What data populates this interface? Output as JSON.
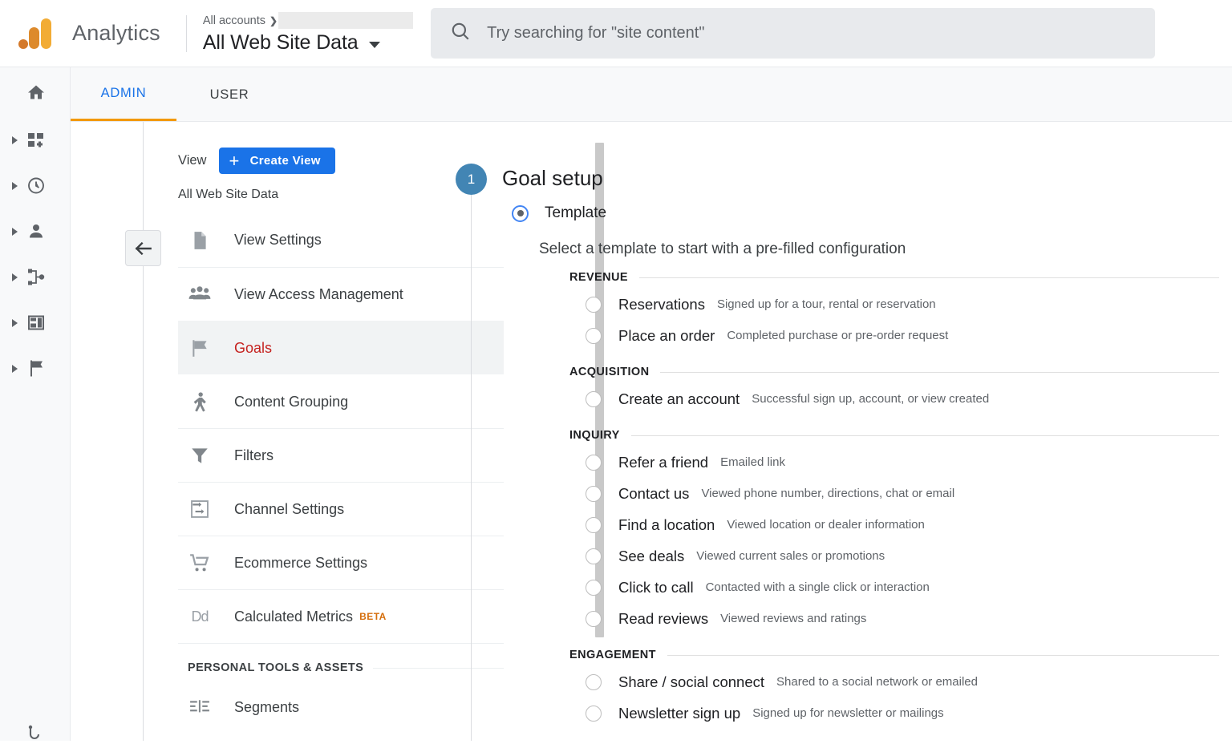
{
  "topbar": {
    "brand": "Analytics",
    "breadcrumb_root": "All accounts",
    "breadcrumb_chevron": "❯",
    "view_name": "All Web Site Data",
    "search_placeholder": "Try searching for \"site content\""
  },
  "rail": {
    "items": [
      {
        "name": "home",
        "icon": "home-icon",
        "expandable": false
      },
      {
        "name": "customization",
        "icon": "customization-icon",
        "expandable": true
      },
      {
        "name": "realtime",
        "icon": "clock-icon",
        "expandable": true
      },
      {
        "name": "audience",
        "icon": "person-icon",
        "expandable": true
      },
      {
        "name": "acquisition",
        "icon": "share-nodes-icon",
        "expandable": true
      },
      {
        "name": "behavior",
        "icon": "window-layout-icon",
        "expandable": true
      },
      {
        "name": "conversions",
        "icon": "flag-icon",
        "expandable": true
      }
    ],
    "bottom_icon": "discover-icon"
  },
  "tabs": [
    {
      "id": "admin",
      "label": "ADMIN",
      "active": true
    },
    {
      "id": "user",
      "label": "USER",
      "active": false
    }
  ],
  "view_panel": {
    "column_label": "View",
    "create_button": "Create View",
    "create_plus": "+",
    "current_view": "All Web Site Data",
    "menu": [
      {
        "label": "View Settings",
        "icon": "document-icon",
        "selected": false
      },
      {
        "label": "View Access Management",
        "icon": "people-icon",
        "selected": false
      },
      {
        "label": "Goals",
        "icon": "flag-icon",
        "selected": true
      },
      {
        "label": "Content Grouping",
        "icon": "content-grouping-icon",
        "selected": false
      },
      {
        "label": "Filters",
        "icon": "funnel-icon",
        "selected": false
      },
      {
        "label": "Channel Settings",
        "icon": "channel-settings-icon",
        "selected": false
      },
      {
        "label": "Ecommerce Settings",
        "icon": "shopping-cart-icon",
        "selected": false
      },
      {
        "label": "Calculated Metrics",
        "icon": "dd-icon",
        "badge": "BETA",
        "selected": false
      }
    ],
    "section_title": "PERSONAL TOOLS & ASSETS",
    "section_menu": [
      {
        "label": "Segments",
        "icon": "segments-icon",
        "selected": false
      }
    ]
  },
  "goal_setup": {
    "step_number": "1",
    "step_title": "Goal setup",
    "template_option_label": "Template",
    "template_option_selected": true,
    "template_description": "Select a template to start with a pre-filled configuration",
    "groups": [
      {
        "name": "REVENUE",
        "options": [
          {
            "label": "Reservations",
            "desc": "Signed up for a tour, rental or reservation",
            "selected": false
          },
          {
            "label": "Place an order",
            "desc": "Completed purchase or pre-order request",
            "selected": false
          }
        ]
      },
      {
        "name": "ACQUISITION",
        "options": [
          {
            "label": "Create an account",
            "desc": "Successful sign up, account, or view created",
            "selected": false
          }
        ]
      },
      {
        "name": "INQUIRY",
        "options": [
          {
            "label": "Refer a friend",
            "desc": "Emailed link",
            "selected": false
          },
          {
            "label": "Contact us",
            "desc": "Viewed phone number, directions, chat or email",
            "selected": false
          },
          {
            "label": "Find a location",
            "desc": "Viewed location or dealer information",
            "selected": false
          },
          {
            "label": "See deals",
            "desc": "Viewed current sales or promotions",
            "selected": false
          },
          {
            "label": "Click to call",
            "desc": "Contacted with a single click or interaction",
            "selected": false
          },
          {
            "label": "Read reviews",
            "desc": "Viewed reviews and ratings",
            "selected": false
          }
        ]
      },
      {
        "name": "ENGAGEMENT",
        "options": [
          {
            "label": "Share / social connect",
            "desc": "Shared to a social network or emailed",
            "selected": false
          },
          {
            "label": "Newsletter sign up",
            "desc": "Signed up for newsletter or mailings",
            "selected": false
          }
        ]
      }
    ]
  },
  "colors": {
    "brand_blue": "#1a73e8",
    "accent_orange": "#f29900",
    "selected_red": "#c5221f",
    "beta_orange": "#d56e0c",
    "step_badge_blue": "#4285b4"
  }
}
